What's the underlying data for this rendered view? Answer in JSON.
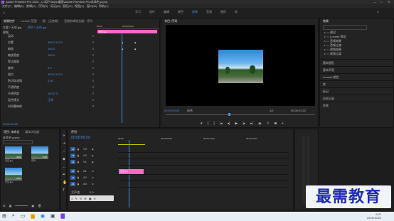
{
  "window": {
    "title": "Adobe Premiere Pro 2020 - C:\\用户\\ls\\ps\\桌面\\Adobe Premiere Pro\\未命名.prproj"
  },
  "menu": [
    "文件(F)",
    "编辑(E)",
    "剪辑(C)",
    "序列(S)",
    "标记(M)",
    "图形(G)",
    "视图(V)",
    "窗口(W)",
    "帮助(H)"
  ],
  "workspaces": [
    "学习",
    "组件",
    "编辑",
    "颜色",
    "效果",
    "音频",
    "图形",
    "库"
  ],
  "active_workspace": "效果",
  "effect_controls": {
    "tabs": [
      "效果控件",
      "Lumetri 范围",
      "源：(无剪辑)",
      "音频剪辑混合器：序列"
    ],
    "source_label": "主要 * 天空.jpg",
    "sequence_label": "序列 * 天空.jpg",
    "timecode_start": "00:00",
    "timecode_mid": "00:00:05:00",
    "clip_name": "天空.jpg",
    "section_video": "视频",
    "rows": [
      {
        "label": "运动",
        "value": ""
      },
      {
        "label": "位置",
        "value": "360.0  240.0"
      },
      {
        "label": "缩放",
        "value": "100.0"
      },
      {
        "label": "缩放宽度",
        "value": "100.0"
      },
      {
        "label": "等比缩放",
        "value": ""
      },
      {
        "label": "旋转",
        "value": "0.0"
      },
      {
        "label": "锚点",
        "value": "360.0  240.0"
      },
      {
        "label": "防闪烁滤镜",
        "value": "0.00"
      },
      {
        "label": "不透明度",
        "value": ""
      },
      {
        "label": "不透明度",
        "value": "100.0 %"
      },
      {
        "label": "混合模式",
        "value": "正常"
      },
      {
        "label": "时间重映射",
        "value": ""
      }
    ],
    "bottom_timecode": "00:00:00:00"
  },
  "program_monitor": {
    "tab": "节目: 序列",
    "timecode": "00:00:00:00",
    "fit": "适合",
    "resolution": "1/2",
    "duration": "00:00:01:22"
  },
  "effects_panel": {
    "tab": "效果",
    "tree": [
      "预设",
      "Lumetri 预设",
      "音频效果",
      "音频过渡",
      "视频效果",
      "视频过渡"
    ],
    "sections": [
      "基本图形",
      "基本声音",
      "Lumetri 颜色",
      "库",
      "标记",
      "历史记录",
      "信息"
    ]
  },
  "project_panel": {
    "tabs": [
      "项目: 未命名",
      "媒体浏览器"
    ],
    "file": "未命名.prproj",
    "items": [
      {
        "name": "天空.jpg",
        "duration": "4:29"
      },
      {
        "name": "序列",
        "duration": "4:29"
      },
      {
        "name": "天空.jpg",
        "duration": "4:29"
      }
    ]
  },
  "timeline": {
    "tab": "序列",
    "timecode": "00:00:00:20",
    "ruler": [
      "00:00",
      "00:00:05:00",
      "00:00:10:00",
      "00:00:15:00"
    ],
    "tracks": [
      "V3",
      "V2",
      "V1",
      "A1",
      "A2",
      "A3"
    ],
    "master": "主声道",
    "master_value": "0.0",
    "clip": "天空.jpg"
  },
  "watermark": "最需教育",
  "taskbar": {
    "time": "9:27",
    "date": "2021/10/22"
  },
  "colors": {
    "accent": "#4a90e2",
    "clip": "#ff66cc",
    "bg": "#1d1d1d"
  }
}
